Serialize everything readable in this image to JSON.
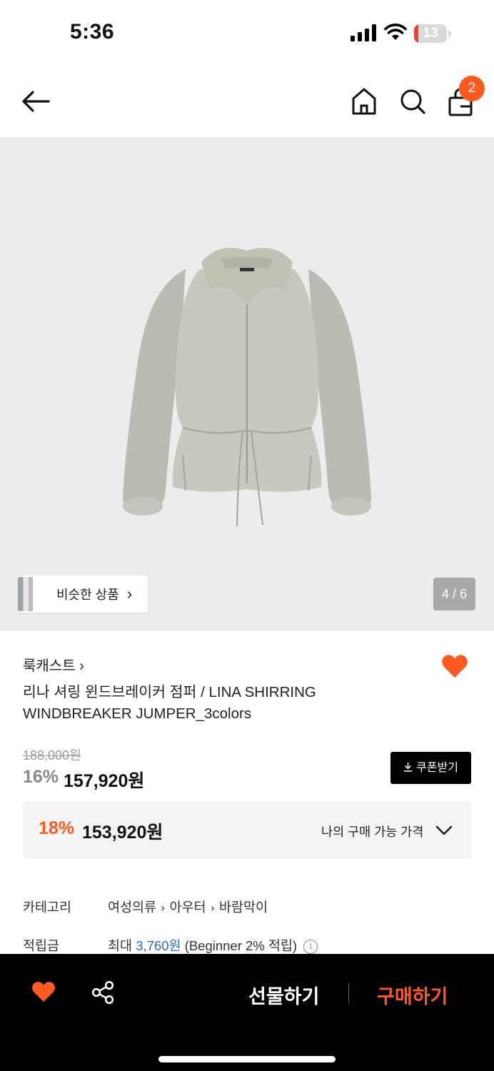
{
  "status_bar": {
    "time": "5:36",
    "battery_level": "13",
    "battery_fraction": 0.13,
    "battery_color": "#ea4335"
  },
  "nav": {
    "back_icon": "arrow-left-icon",
    "home_icon": "home-icon",
    "search_icon": "search-icon",
    "cart_icon": "shopping-bag-icon",
    "cart_badge": "2",
    "badge_color": "#ff5a1f"
  },
  "hero": {
    "image": "light sage green shirring windbreaker jacket",
    "similar_label": "비슷한 상품",
    "similar_chevron": "›",
    "counter": "4 / 6"
  },
  "product": {
    "brand": "룩캐스트 ›",
    "title": "리나 셔링 윈드브레이커 점퍼 / LINA SHIRRING WINDBREAKER JUMPER_3colors",
    "original_price": "188,000원",
    "discount_rate": "16%",
    "sale_price": "157,920원",
    "coupon_label": "쿠폰받기",
    "wishlisted": true
  },
  "my_price": {
    "rate": "18%",
    "price": "153,920원",
    "label": "나의 구매 가능 가격"
  },
  "details": {
    "category_label": "카테고리",
    "category_path": [
      "여성의류",
      "아우터",
      "바람막이"
    ],
    "points_label": "적립금",
    "points_prefix": "최대",
    "points_amount": "3,760원",
    "points_suffix": "(Beginner 2% 적립)",
    "info_glyph": "i"
  },
  "bottom_bar": {
    "gift_label": "선물하기",
    "buy_label": "구매하기",
    "accent_color": "#ff5a1f"
  }
}
